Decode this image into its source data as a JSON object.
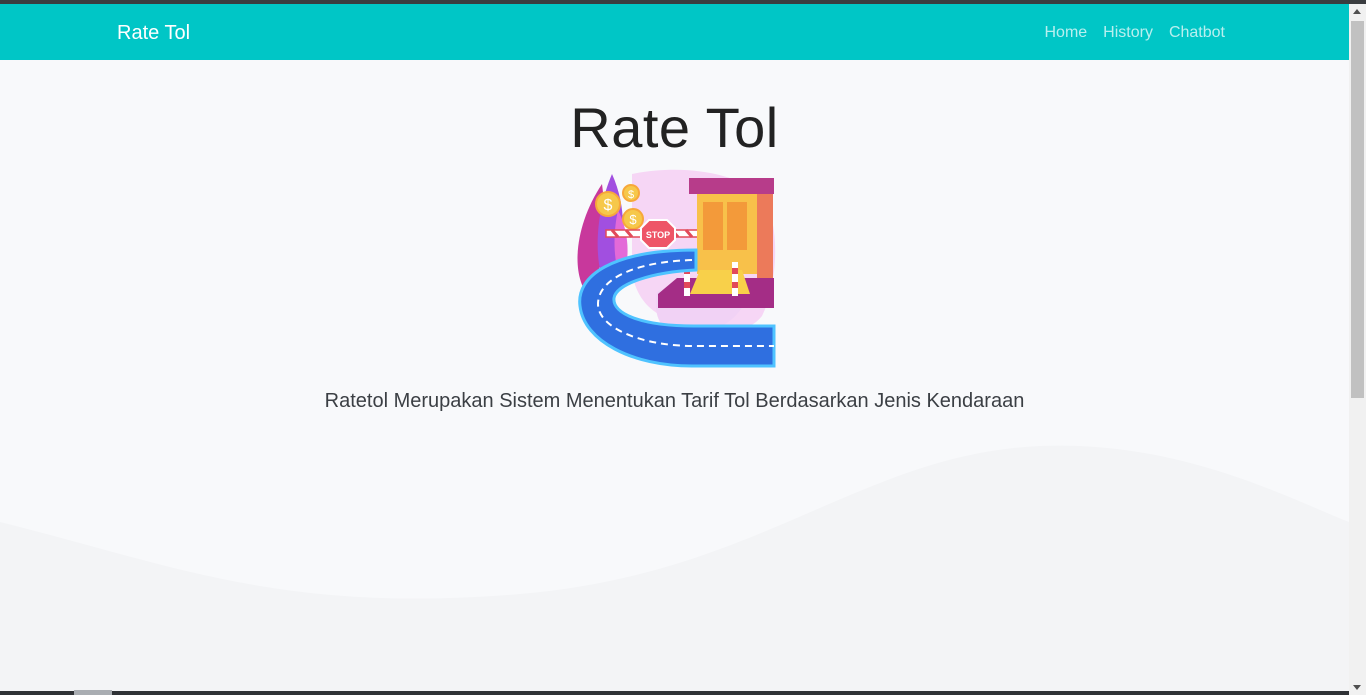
{
  "navbar": {
    "brand": "Rate Tol",
    "links": [
      {
        "label": "Home"
      },
      {
        "label": "History"
      },
      {
        "label": "Chatbot"
      }
    ]
  },
  "hero": {
    "title": "Rate Tol",
    "description": "Ratetol Merupakan Sistem Menentukan Tarif Tol Berdasarkan Jenis Kendaraan",
    "illustration": {
      "icon": "toll-gate-illustration-icon",
      "sign_text": "STOP",
      "coin_symbol": "$"
    }
  },
  "colors": {
    "navbar": "#00c6c6",
    "background": "#f8f9fb",
    "wave": "#f3f4f6",
    "road": "#2f6fe0",
    "booth": "#f8c14a",
    "accent": "#c94fd0"
  }
}
